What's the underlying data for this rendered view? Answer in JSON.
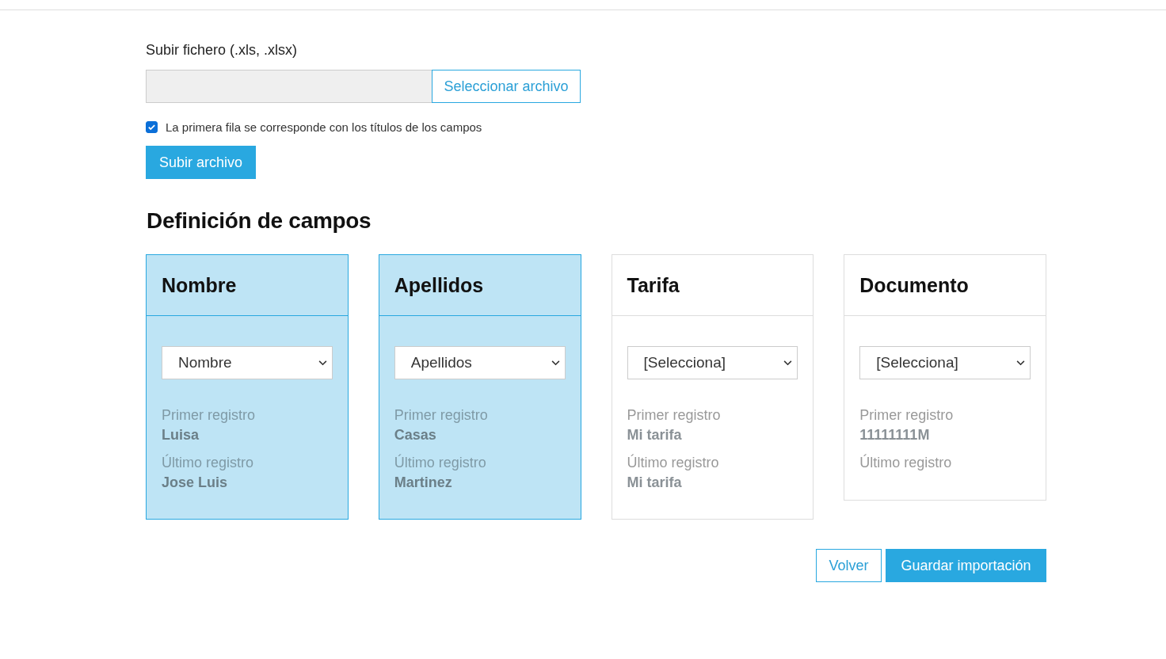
{
  "upload": {
    "label": "Subir fichero (.xls, .xlsx)",
    "browse_button": "Seleccionar archivo",
    "header_row_checkbox": {
      "label": "La primera fila se corresponde con los títulos de los campos",
      "checked": true
    },
    "upload_button": "Subir archivo"
  },
  "section_title": "Definición de campos",
  "fields": [
    {
      "title": "Nombre",
      "selected": true,
      "select_value": "Nombre",
      "first_label": "Primer registro",
      "first_value": "Luisa",
      "last_label": "Último registro",
      "last_value": "Jose Luis"
    },
    {
      "title": "Apellidos",
      "selected": true,
      "select_value": "Apellidos",
      "first_label": "Primer registro",
      "first_value": "Casas",
      "last_label": "Último registro",
      "last_value": "Martinez"
    },
    {
      "title": "Tarifa",
      "selected": false,
      "select_value": "[Selecciona]",
      "first_label": "Primer registro",
      "first_value": "Mi tarifa",
      "last_label": "Último registro",
      "last_value": "Mi tarifa"
    },
    {
      "title": "Documento",
      "selected": false,
      "select_value": "[Selecciona]",
      "first_label": "Primer registro",
      "first_value": "11111111M",
      "last_label": "Último registro"
    }
  ],
  "buttons": {
    "back": "Volver",
    "save": "Guardar importación"
  }
}
